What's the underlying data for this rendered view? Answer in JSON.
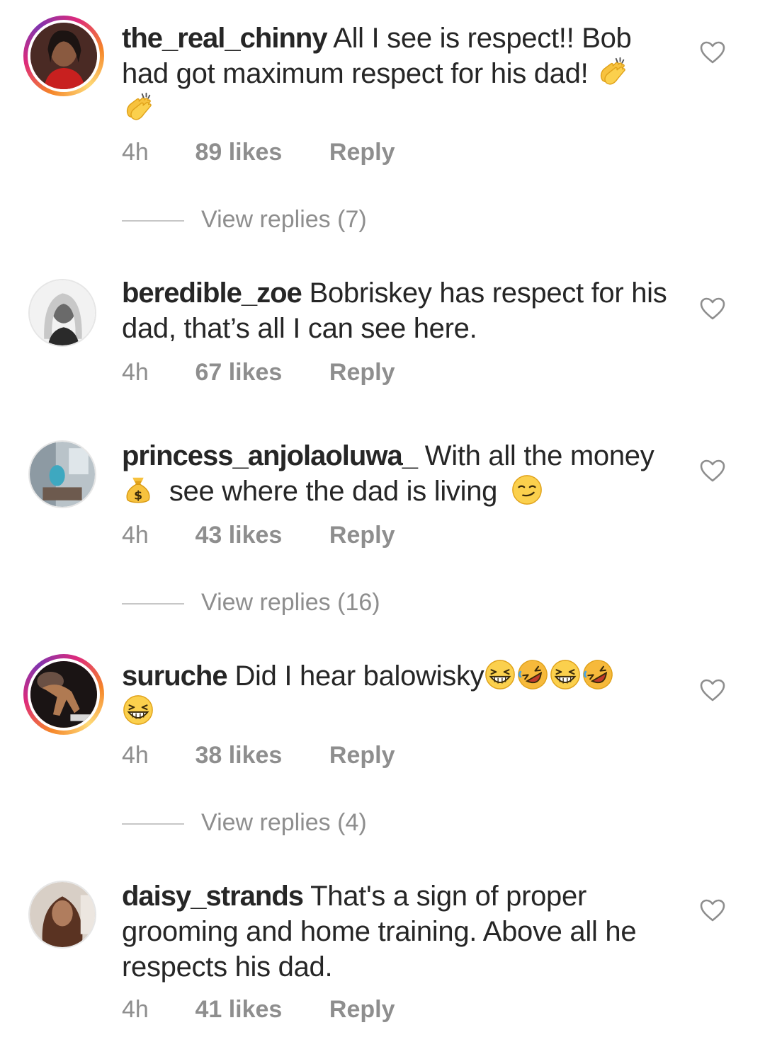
{
  "colors": {
    "text": "#262626",
    "meta": "#8e8e8e",
    "story_ring": "#dd2a7b"
  },
  "comments": [
    {
      "username": "the_real_chinny",
      "text_before": "All I see is respect!! Bob had got maximum respect for his dad!",
      "emojis": [
        "clapping-hands",
        "clapping-hands"
      ],
      "time": "4h",
      "likes": "89 likes",
      "reply": "Reply",
      "view_replies": "View replies (7)"
    },
    {
      "username": "beredible_zoe",
      "text_before": "Bobriskey has respect for his dad, that’s all I can see here.",
      "time": "4h",
      "likes": "67 likes",
      "reply": "Reply"
    },
    {
      "username": "princess_anjolaoluwa_",
      "text_before": "With all the money",
      "emoji_mid": "money-bag",
      "text_after": "see where the dad is living",
      "emoji_end": "smirking-face",
      "time": "4h",
      "likes": "43 likes",
      "reply": "Reply",
      "view_replies": "View replies (16)"
    },
    {
      "username": "suruche",
      "text_before": "Did I hear balowisky",
      "emojis": [
        "grinning-squinting-face",
        "rolling-laughing-face",
        "grinning-squinting-face",
        "rolling-laughing-face",
        "grinning-squinting-face"
      ],
      "time": "4h",
      "likes": "38 likes",
      "reply": "Reply",
      "view_replies": "View replies (4)"
    },
    {
      "username": "daisy_strands",
      "text_before": "That's a sign of proper grooming and home training. Above all he respects his dad.",
      "time": "4h",
      "likes": "41 likes",
      "reply": "Reply"
    }
  ]
}
